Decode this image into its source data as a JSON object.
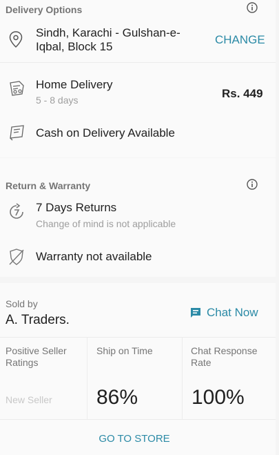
{
  "delivery": {
    "title": "Delivery Options",
    "address_line1": "Sindh, Karachi - Gulshan-e-",
    "address_line2": "Iqbal, Block 15",
    "change_label": "CHANGE",
    "home_delivery_label": "Home Delivery",
    "home_delivery_eta": "5 - 8 days",
    "home_delivery_price": "Rs. 449",
    "cod_label": "Cash on Delivery Available"
  },
  "return_warranty": {
    "title": "Return & Warranty",
    "returns_label": "7 Days Returns",
    "returns_note": "Change of mind is not applicable",
    "warranty_label": "Warranty not available"
  },
  "seller": {
    "sold_by_label": "Sold by",
    "name": "A. Traders.",
    "chat_label": "Chat Now",
    "metrics": [
      {
        "label": "Positive Seller Ratings",
        "value": "New Seller"
      },
      {
        "label": "Ship on Time",
        "value": "86%"
      },
      {
        "label": "Chat Response Rate",
        "value": "100%"
      }
    ],
    "go_to_store_label": "GO TO STORE"
  },
  "colors": {
    "accent": "#2b8aa6",
    "muted": "#9e9e9e",
    "placeholder": "#c8c8c8"
  }
}
